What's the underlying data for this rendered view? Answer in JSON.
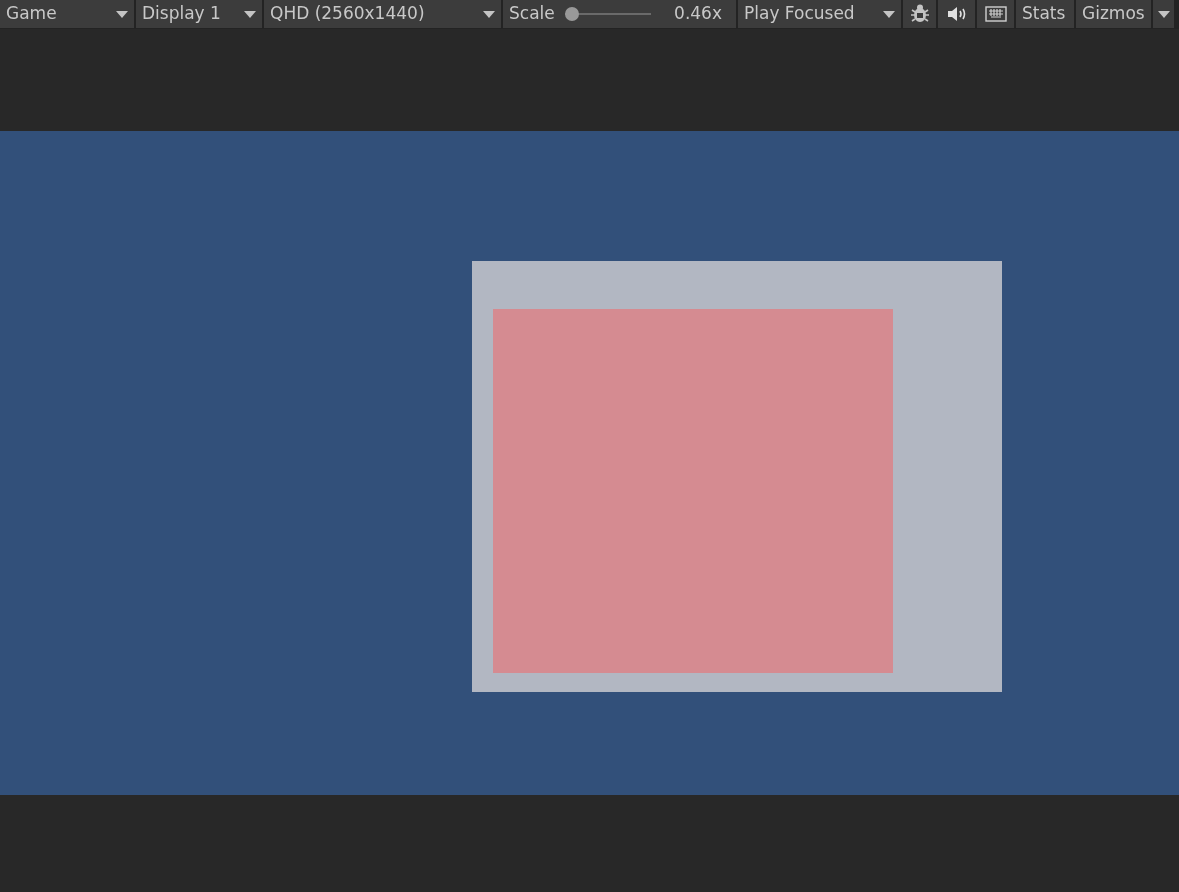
{
  "toolbar": [
    {
      "kind": "dropdown",
      "label": "Game"
    },
    {
      "kind": "dropdown",
      "label": "Display 1"
    },
    {
      "kind": "dropdown",
      "label": "QHD (2560x1440)"
    },
    {
      "kind": "slider",
      "label": "Scale",
      "level": 0.0,
      "reading": "0.46x"
    },
    {
      "kind": "dropdown",
      "label": "Play Focused"
    },
    {
      "kind": "icon"
    },
    {
      "kind": "icon"
    },
    {
      "kind": "icon"
    },
    {
      "kind": "button",
      "label": "Stats"
    },
    {
      "kind": "button",
      "label": "Gizmos"
    },
    {
      "kind": "caret"
    }
  ]
}
